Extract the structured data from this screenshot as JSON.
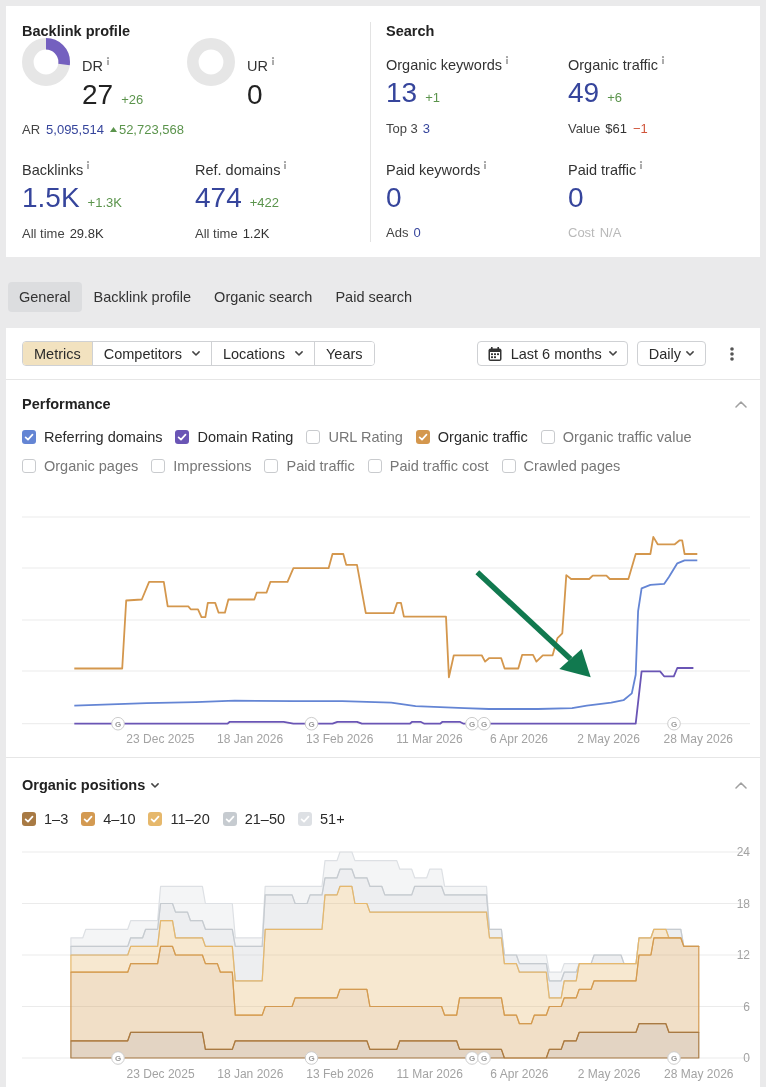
{
  "backlink_profile": {
    "title": "Backlink profile",
    "ratings": [
      {
        "label": "DR",
        "info": true,
        "level": 0.27,
        "value": "27",
        "delta": "+26",
        "rising": true
      },
      {
        "label": "UR",
        "info": true,
        "level": 0,
        "value": "0"
      }
    ],
    "ar": {
      "label": "AR",
      "value": "5,095,514",
      "change": "52,723,568",
      "rising": true
    },
    "metrics": [
      {
        "label": "Backlinks",
        "info": true,
        "value": "1.5K",
        "delta": "+1.3K",
        "rising": true,
        "sub_label": "All time",
        "sub_value": "29.8K",
        "sub_link": false,
        "sub_disabled": false
      },
      {
        "label": "Ref. domains",
        "info": true,
        "value": "474",
        "delta": "+422",
        "rising": true,
        "sub_label": "All time",
        "sub_value": "1.2K",
        "sub_link": false,
        "sub_disabled": false
      }
    ]
  },
  "search": {
    "title": "Search",
    "metrics": [
      {
        "label": "Organic keywords",
        "info": true,
        "value": "13",
        "delta": "+1",
        "rising": true,
        "sub_label": "Top 3",
        "sub_value": "3",
        "sub_link": true,
        "sub_disabled": false
      },
      {
        "label": "Organic traffic",
        "info": true,
        "value": "49",
        "delta": "+6",
        "rising": true,
        "sub_label": "Value",
        "sub_value": "$61",
        "sub_delta": "−1",
        "sub_rising": false,
        "sub_link": false,
        "sub_disabled": false
      },
      {
        "label": "Paid keywords",
        "info": true,
        "value": "0",
        "sub_label": "Ads",
        "sub_value": "0",
        "sub_link": true,
        "sub_disabled": false
      },
      {
        "label": "Paid traffic",
        "info": true,
        "value": "0",
        "sub_label": "Cost",
        "sub_value": "N/A",
        "sub_link": false,
        "sub_disabled": true
      }
    ]
  },
  "tabs": [
    {
      "label": "General",
      "selected": true
    },
    {
      "label": "Backlink profile",
      "selected": false
    },
    {
      "label": "Organic search",
      "selected": false
    },
    {
      "label": "Paid search",
      "selected": false
    }
  ],
  "toolbar": {
    "segments": [
      {
        "label": "Metrics",
        "selected": true,
        "dropdown": false
      },
      {
        "label": "Competitors",
        "selected": false,
        "dropdown": true
      },
      {
        "label": "Locations",
        "selected": false,
        "dropdown": true
      },
      {
        "label": "Years",
        "selected": false,
        "dropdown": false
      }
    ],
    "date_range": {
      "label": "Last 6 months"
    },
    "interval": {
      "label": "Daily"
    }
  },
  "performance": {
    "title": "Performance",
    "expanded": true,
    "toggles": [
      {
        "label": "Referring domains",
        "checked": true,
        "color": "#6485d4"
      },
      {
        "label": "Domain Rating",
        "checked": true,
        "color": "#6a55b5"
      },
      {
        "label": "URL Rating",
        "checked": false
      },
      {
        "label": "Organic traffic",
        "checked": true,
        "color": "#d4974d"
      },
      {
        "label": "Organic traffic value",
        "checked": false
      },
      {
        "label": "Organic pages",
        "checked": false
      },
      {
        "label": "Impressions",
        "checked": false
      },
      {
        "label": "Paid traffic",
        "checked": false
      },
      {
        "label": "Paid traffic cost",
        "checked": false
      },
      {
        "label": "Crawled pages",
        "checked": false
      }
    ],
    "x_labels": [
      "23 Dec 2025",
      "18 Jan 2026",
      "13 Feb 2026",
      "11 Mar 2026",
      "6 Apr 2026",
      "2 May 2026",
      "28 May 2026"
    ],
    "update_markers": [
      "G",
      "G",
      "G",
      "G",
      "G"
    ]
  },
  "positions": {
    "title": "Organic positions",
    "expanded": true,
    "legend": [
      {
        "checked": true
      },
      {
        "checked": true
      },
      {
        "checked": true
      },
      {
        "checked": true
      },
      {
        "checked": true
      }
    ],
    "update_markers": [
      "G",
      "G",
      "G",
      "G",
      "G"
    ],
    "chart_data": {
      "type": "area",
      "stacked": true,
      "grid": true,
      "categories": [
        null,
        null,
        null,
        null,
        null,
        null,
        "23 Dec 2025",
        null,
        null,
        null,
        null,
        null,
        "18 Jan 2026",
        null,
        null,
        null,
        null,
        null,
        "13 Feb 2026",
        null,
        null,
        null,
        null,
        null,
        "11 Mar 2026",
        null,
        null,
        null,
        null,
        null,
        "6 Apr 2026",
        null,
        null,
        null,
        null,
        null,
        "2 May 2026",
        null,
        null,
        null,
        null,
        null,
        "28 May 2026"
      ],
      "ylim": [
        0,
        24
      ],
      "yticks": [
        0,
        6,
        12,
        18,
        24
      ],
      "series": [
        {
          "name": "1–3",
          "color": "#a87a44",
          "values": [
            2,
            2,
            2,
            2,
            3,
            3,
            3,
            3,
            3,
            1,
            1,
            2,
            2,
            2,
            2,
            2,
            2,
            2,
            2,
            2,
            1,
            1,
            2,
            2,
            2,
            2,
            1,
            1,
            1,
            0,
            0,
            0,
            1,
            2,
            3,
            3,
            3,
            3,
            4,
            4,
            3,
            3,
            3
          ]
        },
        {
          "name": "4–10",
          "color": "#d39a52",
          "values": [
            8,
            8,
            8,
            8,
            8,
            8,
            10,
            9,
            9,
            10,
            9,
            3,
            3,
            4,
            4,
            5,
            5,
            5,
            6,
            6,
            5,
            5,
            4,
            4,
            4,
            3,
            6,
            6,
            6,
            5,
            4,
            5,
            5,
            5,
            5,
            6,
            6,
            6,
            8,
            10,
            11,
            10,
            10
          ]
        },
        {
          "name": "11–20",
          "color": "#e6b86c",
          "values": [
            2,
            2,
            2,
            2,
            2,
            2,
            3,
            2,
            2,
            2,
            3,
            4,
            4,
            9,
            9,
            8,
            8,
            12,
            12,
            10,
            11,
            11,
            11,
            11,
            11,
            12,
            10,
            10,
            7,
            6,
            6,
            5,
            1,
            2,
            3,
            2,
            2,
            2,
            2,
            1,
            0,
            0,
            0
          ]
        },
        {
          "name": "21–50",
          "color": "#c6cbd0",
          "values": [
            1,
            1,
            1,
            1,
            1,
            2,
            2,
            3,
            2,
            2,
            2,
            4,
            4,
            4,
            4,
            3,
            4,
            2,
            2,
            3,
            3,
            2,
            2,
            3,
            3,
            2,
            2,
            2,
            1,
            1,
            1,
            1,
            2,
            1,
            0,
            1,
            1,
            0,
            0,
            0,
            1,
            0,
            0
          ]
        },
        {
          "name": "51+",
          "color": "#dde0e4",
          "values": [
            1,
            2,
            2,
            2,
            2,
            1,
            2,
            3,
            4,
            3,
            3,
            1,
            1,
            1,
            1,
            2,
            1,
            2,
            2,
            2,
            3,
            4,
            3,
            1,
            2,
            1,
            1,
            1,
            0,
            0,
            1,
            1,
            1,
            1,
            0,
            0,
            0,
            0,
            0,
            0,
            0,
            0,
            0
          ]
        }
      ]
    }
  }
}
